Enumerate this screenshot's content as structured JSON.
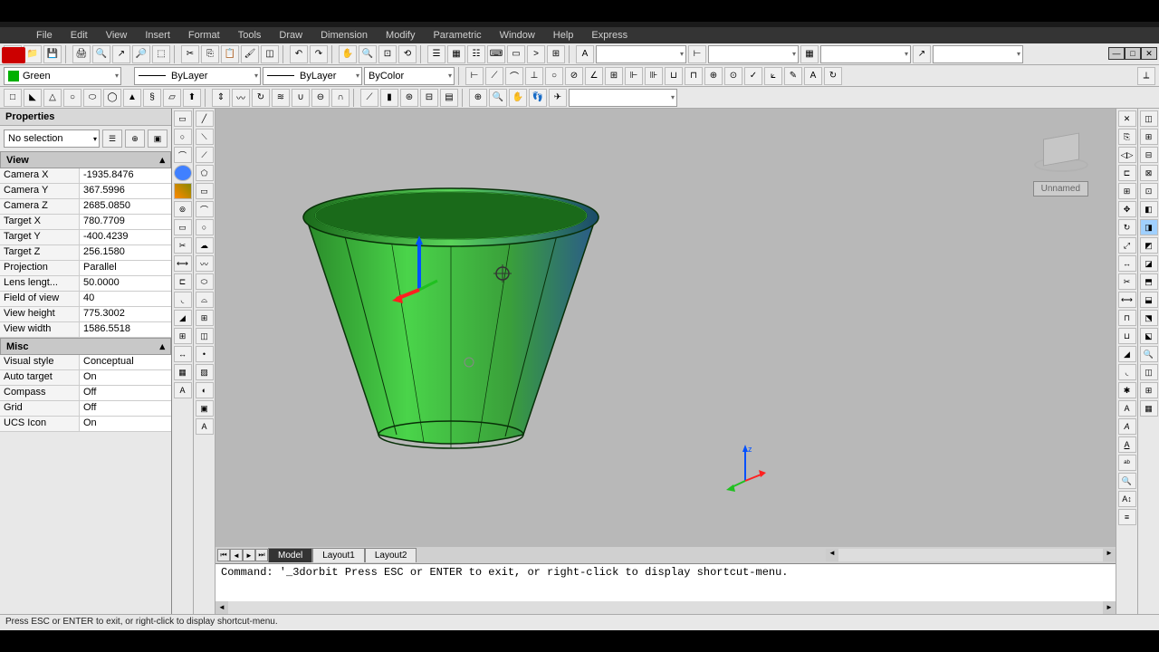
{
  "menu": [
    "File",
    "Edit",
    "View",
    "Insert",
    "Format",
    "Tools",
    "Draw",
    "Dimension",
    "Modify",
    "Parametric",
    "Window",
    "Help",
    "Express"
  ],
  "layer": {
    "color": "#00b000",
    "name": "Green"
  },
  "bylayer1": "ByLayer",
  "bylayer2": "ByLayer",
  "bycolor": "ByColor",
  "properties": {
    "title": "Properties",
    "selection": "No selection",
    "view_header": "View",
    "view": [
      {
        "k": "Camera X",
        "v": "-1935.8476"
      },
      {
        "k": "Camera Y",
        "v": "367.5996"
      },
      {
        "k": "Camera Z",
        "v": "2685.0850"
      },
      {
        "k": "Target X",
        "v": "780.7709"
      },
      {
        "k": "Target Y",
        "v": "-400.4239"
      },
      {
        "k": "Target Z",
        "v": "256.1580"
      },
      {
        "k": "Projection",
        "v": "Parallel"
      },
      {
        "k": "Lens lengt...",
        "v": "50.0000"
      },
      {
        "k": "Field of view",
        "v": "40"
      },
      {
        "k": "View height",
        "v": "775.3002"
      },
      {
        "k": "View width",
        "v": "1586.5518"
      }
    ],
    "misc_header": "Misc",
    "misc": [
      {
        "k": "Visual style",
        "v": "Conceptual"
      },
      {
        "k": "Auto target",
        "v": "On"
      },
      {
        "k": "Compass",
        "v": "Off"
      },
      {
        "k": "Grid",
        "v": "Off"
      },
      {
        "k": "UCS Icon",
        "v": "On"
      }
    ]
  },
  "viewcube_label": "Unnamed",
  "tabs": {
    "active": "Model",
    "others": [
      "Layout1",
      "Layout2"
    ]
  },
  "cmd": "Command: '_3dorbit Press ESC or ENTER to exit, or right-click to display shortcut-menu.",
  "status": "Press ESC or ENTER to exit, or right-click to display shortcut-menu."
}
